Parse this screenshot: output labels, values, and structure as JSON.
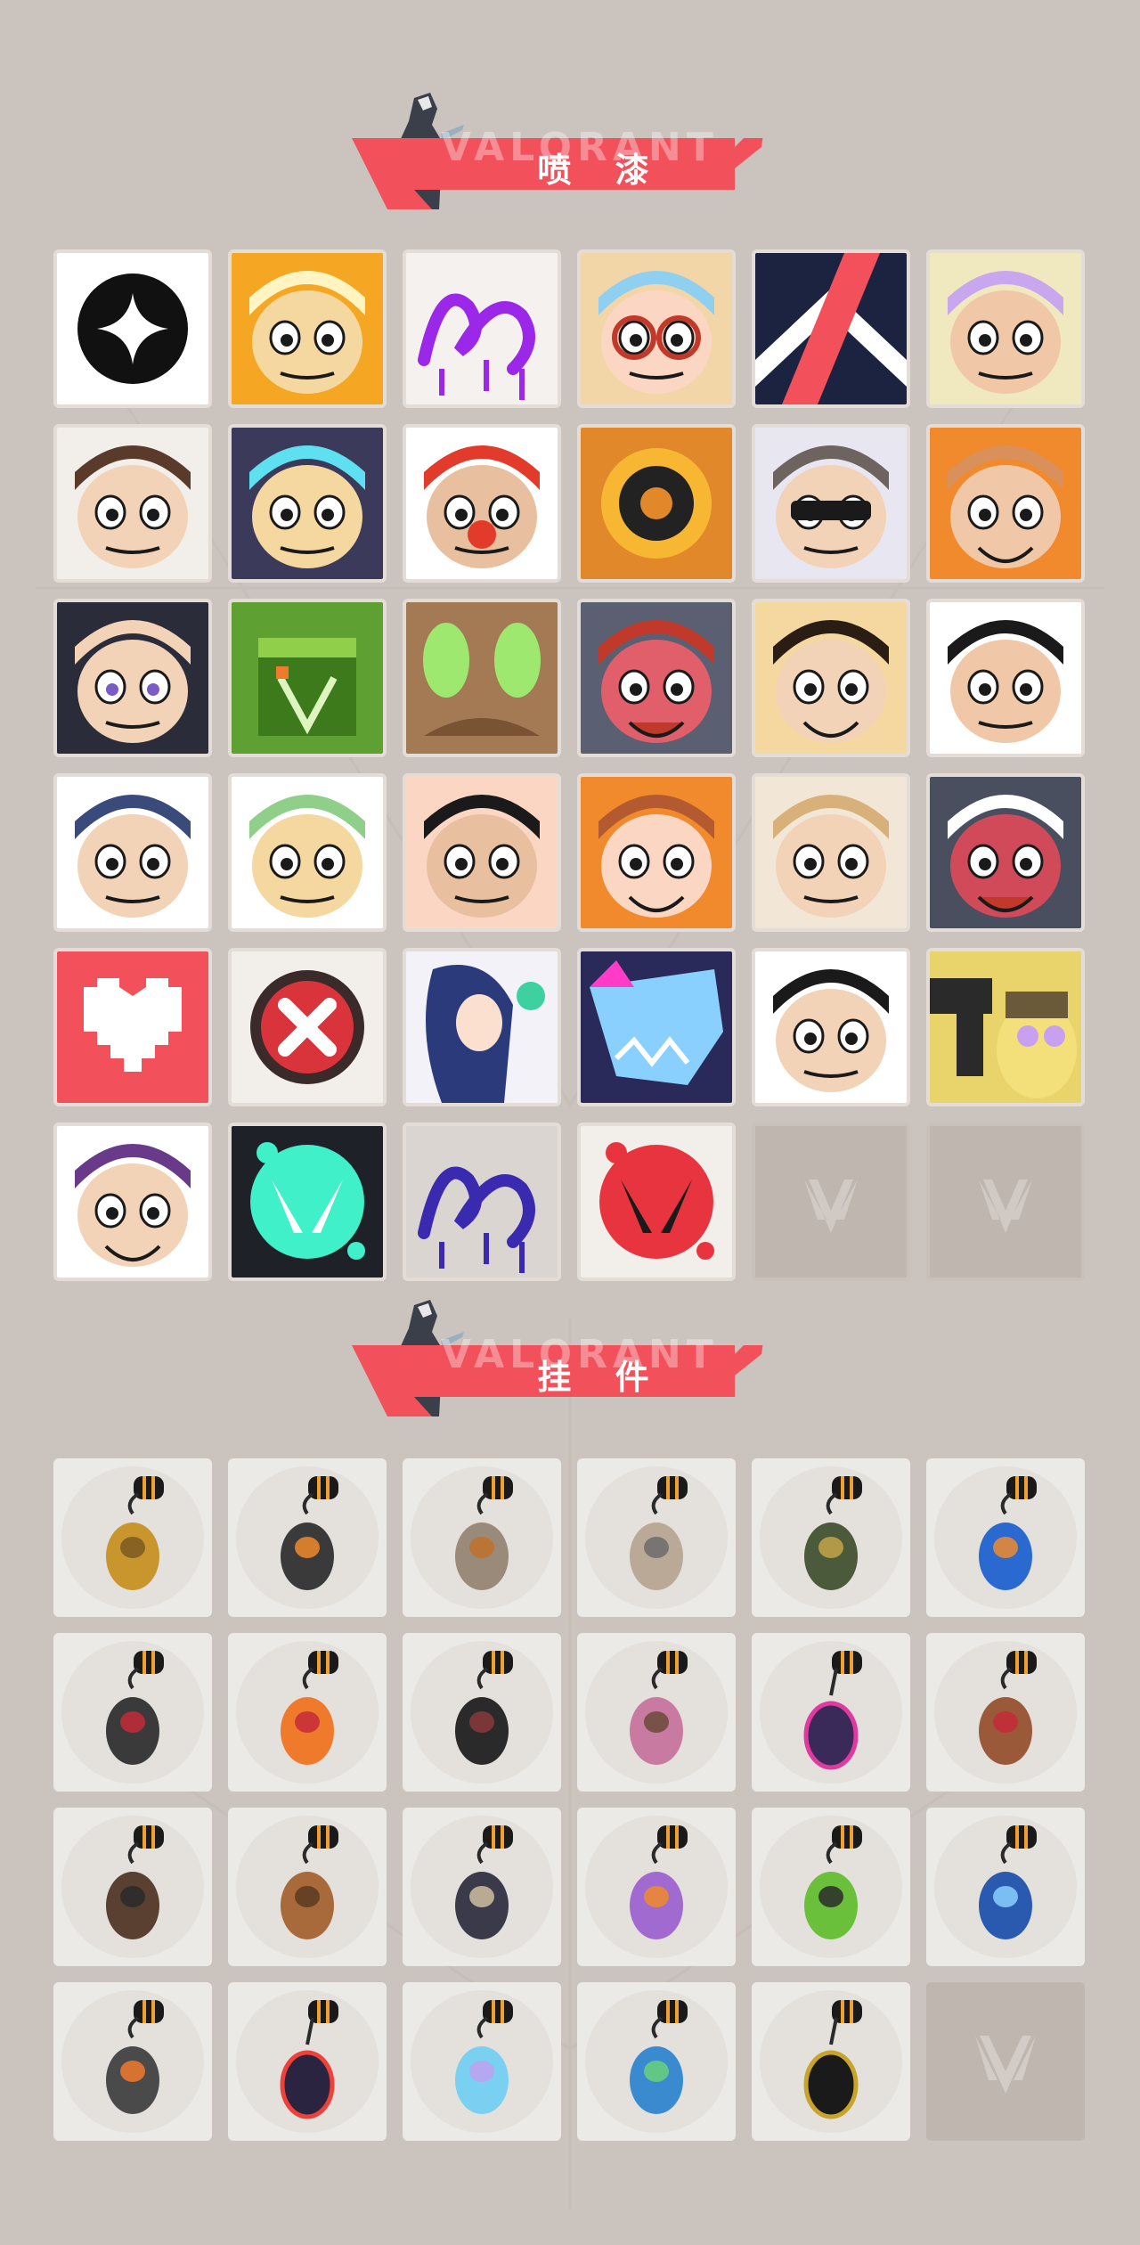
{
  "sections": [
    {
      "title": "喷 漆",
      "ghost": "VALORANT"
    },
    {
      "title": "挂 件",
      "ghost": "VALORANT"
    }
  ],
  "sprays": [
    {
      "name": "spray-black-star-badge",
      "bg": "#ffffff",
      "fg": "#111111",
      "accent": "#ffffff"
    },
    {
      "name": "spray-golden-mask",
      "bg": "#f5a623",
      "fg": "#fff4c2",
      "accent": "#d9480f"
    },
    {
      "name": "spray-purple-graffiti",
      "bg": "#f4f1ee",
      "fg": "#9b28e8",
      "accent": "#9b28e8"
    },
    {
      "name": "spray-goggles-old-man",
      "bg": "#f3d6a8",
      "fg": "#8fd0f0",
      "accent": "#c0392b"
    },
    {
      "name": "spray-chevron-logo",
      "bg": "#1c2340",
      "fg": "#ffffff",
      "accent": "#f2515b"
    },
    {
      "name": "spray-cat-snack",
      "bg": "#f0e9c0",
      "fg": "#c9a7ef",
      "accent": "#f4d84a"
    },
    {
      "name": "spray-pixel-agent",
      "bg": "#f2efeb",
      "fg": "#5a3a2a",
      "accent": "#222222"
    },
    {
      "name": "spray-robot-helmet",
      "bg": "#3b3a5a",
      "fg": "#5ee0f0",
      "accent": "#d98c2b"
    },
    {
      "name": "spray-clown",
      "bg": "#ffffff",
      "fg": "#e23b2b",
      "accent": "#3aa0e0"
    },
    {
      "name": "spray-orange-dial",
      "bg": "#e0882a",
      "fg": "#222222",
      "accent": "#f7b733"
    },
    {
      "name": "spray-raccoon-sunglasses",
      "bg": "#e8e6f0",
      "fg": "#6d6460",
      "accent": "#1a1a1a"
    },
    {
      "name": "spray-bearded-grin",
      "bg": "#f08a2c",
      "fg": "#d9905a",
      "accent": "#3a2218"
    },
    {
      "name": "spray-bandaged-boy",
      "bg": "#2a2c3a",
      "fg": "#f3d3b8",
      "accent": "#7b5cc7"
    },
    {
      "name": "spray-green-crate",
      "bg": "#5fa033",
      "fg": "#3c7a1c",
      "accent": "#f07a2c"
    },
    {
      "name": "spray-brown-bunny-eyes",
      "bg": "#a47a55",
      "fg": "#9fe870",
      "accent": "#7a5335"
    },
    {
      "name": "spray-crying-blob",
      "bg": "#5a5f72",
      "fg": "#e05f6a",
      "accent": "#c0392b"
    },
    {
      "name": "spray-tiger-laugh",
      "bg": "#f5d7a0",
      "fg": "#2a1e14",
      "accent": "#e0a050"
    },
    {
      "name": "spray-scheming-girl",
      "bg": "#ffffff",
      "fg": "#1a1a1a",
      "accent": "#f08a2c"
    },
    {
      "name": "spray-penguin-beanie",
      "bg": "#ffffff",
      "fg": "#3a4a7a",
      "accent": "#f08a2c"
    },
    {
      "name": "spray-frog-butterfly",
      "bg": "#ffffff",
      "fg": "#8fcf8a",
      "accent": "#1a1a1a"
    },
    {
      "name": "spray-meh-face",
      "bg": "#fbd7c3",
      "fg": "#1a1a1a",
      "accent": "#8fc0e8"
    },
    {
      "name": "spray-laughing-agent",
      "bg": "#f08a2c",
      "fg": "#b35a30",
      "accent": "#3a2218"
    },
    {
      "name": "spray-winking-blond",
      "bg": "#f2e6d6",
      "fg": "#d7b07a",
      "accent": "#3a9ad9"
    },
    {
      "name": "spray-screaming-blob",
      "bg": "#4a4f60",
      "fg": "#d14a5a",
      "accent": "#ffffff"
    },
    {
      "name": "spray-pixel-heart",
      "bg": "#f2515b",
      "fg": "#ffffff",
      "accent": "#f2515b"
    },
    {
      "name": "spray-red-x-button",
      "bg": "#f2efeb",
      "fg": "#d9343b",
      "accent": "#ffffff"
    },
    {
      "name": "spray-anime-heroine",
      "bg": "#f2f2f8",
      "fg": "#2a3a7a",
      "accent": "#3fd0a0"
    },
    {
      "name": "spray-blue-shark",
      "bg": "#2a2a5a",
      "fg": "#8ad0ff",
      "accent": "#ff3cc7"
    },
    {
      "name": "spray-pouty-girl",
      "bg": "#ffffff",
      "fg": "#1a1a1a",
      "accent": "#f6a8a0"
    },
    {
      "name": "spray-pistol-banana",
      "bg": "#e8d46a",
      "fg": "#2a2a2a",
      "accent": "#6a5a3a"
    },
    {
      "name": "spray-purple-grin",
      "bg": "#ffffff",
      "fg": "#6a3a8a",
      "accent": "#ff3cf0"
    },
    {
      "name": "spray-valorant-splat-teal",
      "bg": "#1e2228",
      "fg": "#3ff0c8",
      "accent": "#ffffff"
    },
    {
      "name": "spray-drippy-tag",
      "bg": "#dad5d0",
      "fg": "#3a2ab0",
      "accent": "#3a2ab0"
    },
    {
      "name": "spray-red-valorant-splat",
      "bg": "#f2efeb",
      "fg": "#e8343e",
      "accent": "#1a1a1a"
    },
    {
      "name": "spray-empty-slot",
      "bg": "#bfb6b0",
      "fg": "#d2cbc6",
      "accent": "#d2cbc6"
    },
    {
      "name": "spray-empty-slot",
      "bg": "#bfb6b0",
      "fg": "#d2cbc6",
      "accent": "#d2cbc6"
    }
  ],
  "buddies": [
    {
      "name": "buddy-golden-cat",
      "color": "#c9962e",
      "accent": "#7a5a20"
    },
    {
      "name": "buddy-drone-bot",
      "color": "#3a3a3a",
      "accent": "#f08a2c"
    },
    {
      "name": "buddy-fry-basket",
      "color": "#9a8a7a",
      "accent": "#c0702a"
    },
    {
      "name": "buddy-astronaut-cat",
      "color": "#b9a996",
      "accent": "#6b6b6b"
    },
    {
      "name": "buddy-green-satchel",
      "color": "#4a5a3a",
      "accent": "#c4a44a"
    },
    {
      "name": "buddy-blue-canister",
      "color": "#2a6ad0",
      "accent": "#f08a2c"
    },
    {
      "name": "buddy-chainsaw-blade",
      "color": "#3a3a3a",
      "accent": "#c42a3a"
    },
    {
      "name": "buddy-orange-guitar-pick",
      "color": "#f07a2c",
      "accent": "#c42a3a"
    },
    {
      "name": "buddy-dark-rope-loop",
      "color": "#2a2a2a",
      "accent": "#8a3a3a"
    },
    {
      "name": "buddy-cupcake",
      "color": "#c87aa0",
      "accent": "#6a4a3a"
    },
    {
      "name": "buddy-ep9-medal-purple",
      "color": "#3a2a5a",
      "accent": "#e03aa0"
    },
    {
      "name": "buddy-brown-teddy",
      "color": "#9a5a3a",
      "accent": "#c42a3a"
    },
    {
      "name": "buddy-holster-gun",
      "color": "#5a4030",
      "accent": "#2a2a2a"
    },
    {
      "name": "buddy-cardboard-box",
      "color": "#a86a3a",
      "accent": "#5a3a20"
    },
    {
      "name": "buddy-mech-figure",
      "color": "#3a3a4a",
      "accent": "#d0c0a0"
    },
    {
      "name": "buddy-lava-lamp",
      "color": "#a06ad0",
      "accent": "#f08a2c"
    },
    {
      "name": "buddy-green-pager",
      "color": "#6ac03a",
      "accent": "#2a2a2a"
    },
    {
      "name": "buddy-blue-robot",
      "color": "#2a5ab0",
      "accent": "#8ad0ff"
    },
    {
      "name": "buddy-radio-gadget",
      "color": "#4a4a4a",
      "accent": "#f07a2c"
    },
    {
      "name": "buddy-ep9-medal-dark",
      "color": "#2a2440",
      "accent": "#f0403a"
    },
    {
      "name": "buddy-jellyfish",
      "color": "#7ad0f0",
      "accent": "#c0a0f0"
    },
    {
      "name": "buddy-ufo",
      "color": "#3a8ad0",
      "accent": "#6ad07a"
    },
    {
      "name": "buddy-valorant-pendant",
      "color": "#1a1a1a",
      "accent": "#c9a42a"
    },
    {
      "name": "buddy-empty-slot",
      "color": "#bfb6b0",
      "accent": "#d2cbc6"
    }
  ]
}
